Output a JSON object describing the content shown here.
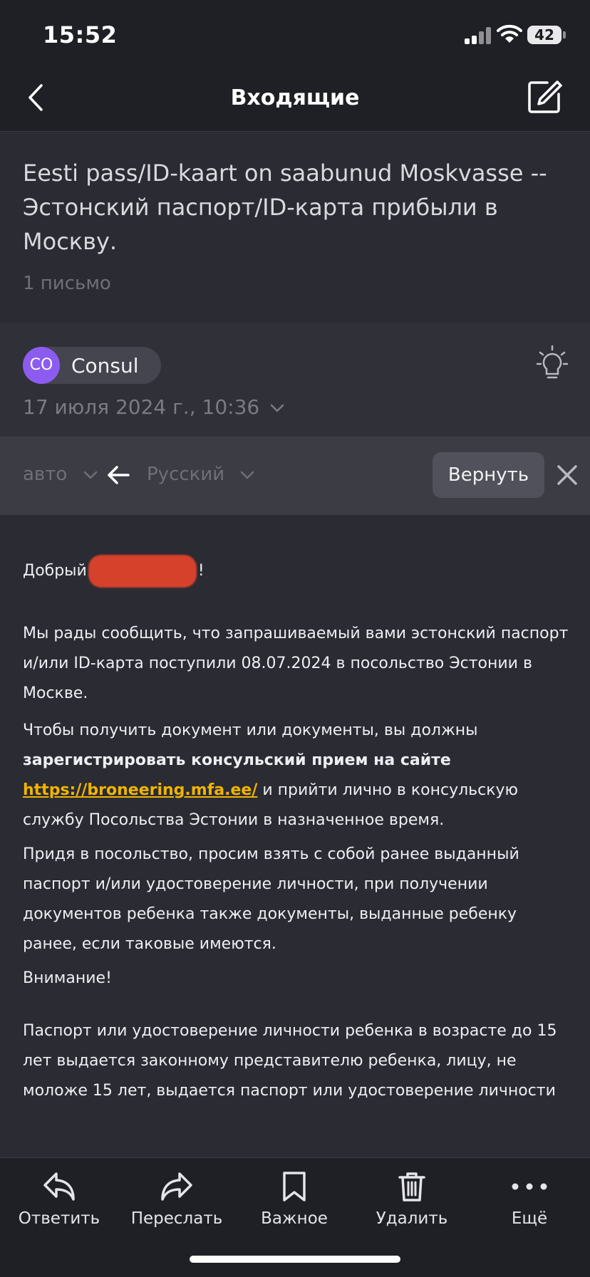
{
  "status_bar": {
    "time": "15:52",
    "battery": "42"
  },
  "nav": {
    "title": "Входящие"
  },
  "email": {
    "subject": "Eesti pass/ID-kaart on saabunud Moskvasse -- Эстонский паспорт/ID-карта прибыли в Москву.",
    "count": "1 письмо",
    "sender_initials": "CO",
    "sender_name": "Consul",
    "date": "17 июля 2024 г., 10:36"
  },
  "translate": {
    "source_lang": "авто",
    "target_lang": "Русский",
    "revert_label": "Вернуть"
  },
  "body": {
    "greeting_start": "Добрый",
    "greeting_end": "!",
    "para1": "Мы рады сообщить, что запрашиваемый вами эстонский паспорт и/или ID-карта поступили 08.07.2024 в посольство Эстонии в Москве.",
    "para2_start": "Чтобы получить документ или документы, вы должны ",
    "para2_bold": "зарегистрировать консульский прием на сайте",
    "para2_link": "https://broneering.mfa.ee/",
    "para2_end": " и прийти лично в консульскую службу Посольства Эстонии в назначенное время.",
    "para3": "Придя в посольство, просим взять с собой ранее выданный паспорт и/или удостоверение личности, при получении документов ребенка также документы, выданные ребенку ранее, если таковые имеются.",
    "para4": "Внимание!",
    "para5": "Паспорт или удостоверение личности ребенка в возрасте до 15 лет выдается законному представителю ребенка, лицу, не моложе 15 лет, выдается паспорт или удостоверение личности"
  },
  "toolbar": {
    "reply": "Ответить",
    "forward": "Переслать",
    "important": "Важное",
    "delete": "Удалить",
    "more": "Ещё"
  },
  "colors": {
    "accent_link": "#f0b400",
    "avatar": "#8c5cf0",
    "redaction": "#d5412a"
  }
}
